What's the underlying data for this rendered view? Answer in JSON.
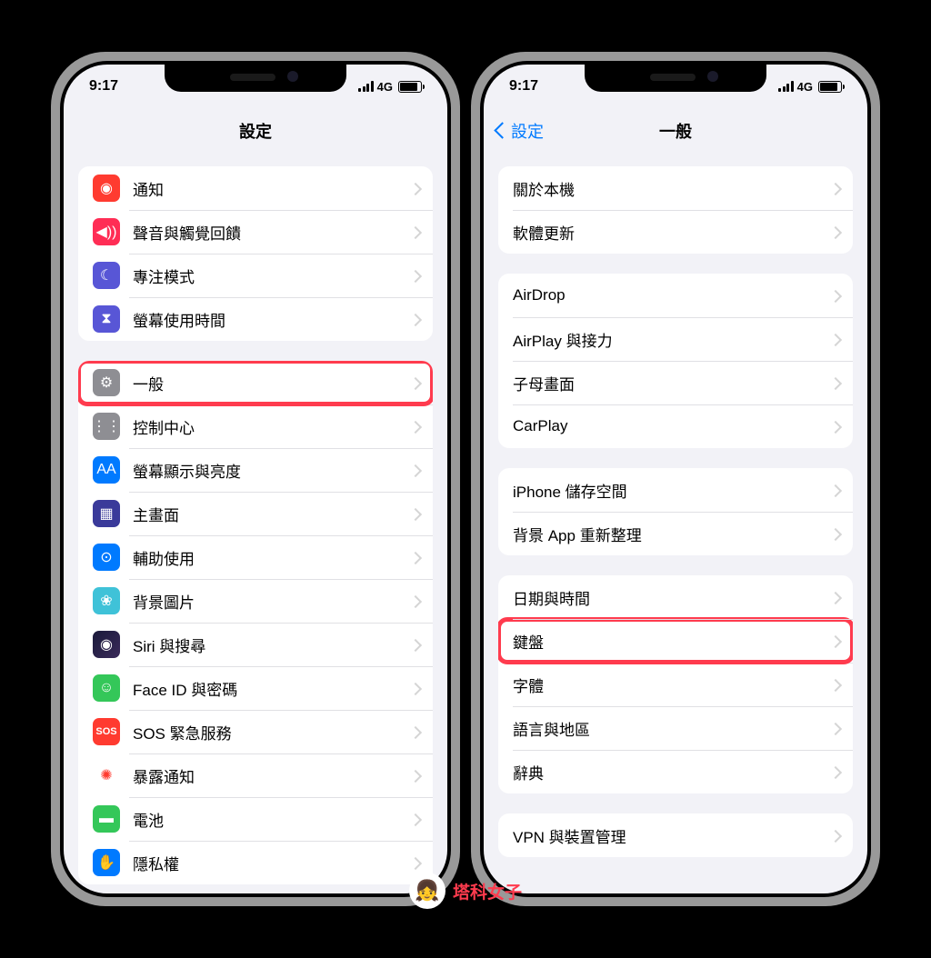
{
  "status": {
    "time": "9:17",
    "network": "4G"
  },
  "left": {
    "title": "設定",
    "groups": [
      [
        {
          "icon": "notif",
          "glyph": "◉",
          "label": "通知"
        },
        {
          "icon": "sound",
          "glyph": "◀))",
          "label": "聲音與觸覺回饋"
        },
        {
          "icon": "focus",
          "glyph": "☾",
          "label": "專注模式"
        },
        {
          "icon": "screentime",
          "glyph": "⧗",
          "label": "螢幕使用時間"
        }
      ],
      [
        {
          "icon": "general",
          "glyph": "⚙",
          "label": "一般",
          "highlight": true
        },
        {
          "icon": "control",
          "glyph": "⋮⋮",
          "label": "控制中心"
        },
        {
          "icon": "display",
          "glyph": "AA",
          "label": "螢幕顯示與亮度"
        },
        {
          "icon": "home",
          "glyph": "▦",
          "label": "主畫面"
        },
        {
          "icon": "access",
          "glyph": "⊙",
          "label": "輔助使用"
        },
        {
          "icon": "wallpaper",
          "glyph": "❀",
          "label": "背景圖片"
        },
        {
          "icon": "siri",
          "glyph": "◉",
          "label": "Siri 與搜尋"
        },
        {
          "icon": "faceid",
          "glyph": "☺",
          "label": "Face ID 與密碼"
        },
        {
          "icon": "sos",
          "glyph": "SOS",
          "label": "SOS 緊急服務"
        },
        {
          "icon": "exposure",
          "glyph": "✺",
          "label": "暴露通知"
        },
        {
          "icon": "battery",
          "glyph": "▬",
          "label": "電池"
        },
        {
          "icon": "privacy",
          "glyph": "✋",
          "label": "隱私權"
        }
      ]
    ]
  },
  "right": {
    "back": "設定",
    "title": "一般",
    "groups": [
      [
        {
          "label": "關於本機"
        },
        {
          "label": "軟體更新"
        }
      ],
      [
        {
          "label": "AirDrop"
        },
        {
          "label": "AirPlay 與接力"
        },
        {
          "label": "子母畫面"
        },
        {
          "label": "CarPlay"
        }
      ],
      [
        {
          "label": "iPhone 儲存空間"
        },
        {
          "label": "背景 App 重新整理"
        }
      ],
      [
        {
          "label": "日期與時間"
        },
        {
          "label": "鍵盤",
          "highlight": true
        },
        {
          "label": "字體"
        },
        {
          "label": "語言與地區"
        },
        {
          "label": "辭典"
        }
      ],
      [
        {
          "label": "VPN 與裝置管理"
        }
      ]
    ]
  },
  "watermark": "塔科女子"
}
